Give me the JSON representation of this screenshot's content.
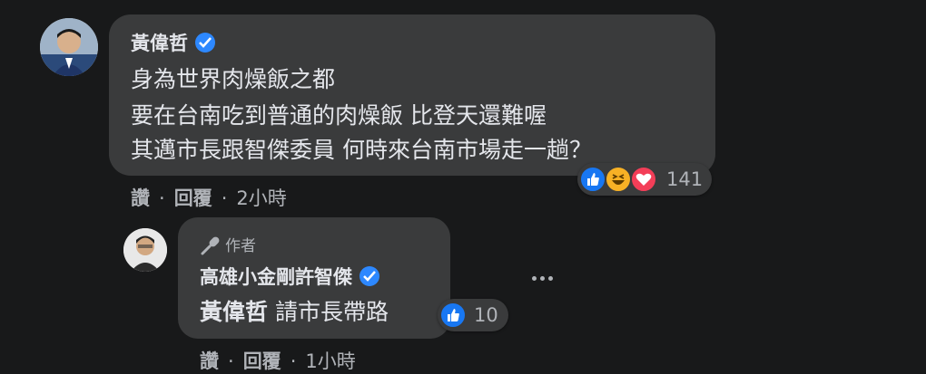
{
  "comment": {
    "author": "黃偉哲",
    "lines": [
      "身為世界肉燥飯之都",
      "要在台南吃到普通的肉燥飯 比登天還難喔",
      "其邁市長跟智傑委員 何時來台南市場走一趟？"
    ],
    "actions": {
      "like": "讚",
      "reply": "回覆",
      "time": "2小時"
    },
    "reactions": {
      "icons": [
        "like-icon",
        "haha-icon",
        "love-icon"
      ],
      "count": "141"
    }
  },
  "reply": {
    "badge": "作者",
    "author": "高雄小金剛許智傑",
    "mention": "黃偉哲",
    "text": "請市長帶路",
    "actions": {
      "like": "讚",
      "reply": "回覆",
      "time": "1小時"
    },
    "reactions": {
      "icons": [
        "like-icon"
      ],
      "count": "10"
    }
  },
  "colors": {
    "background": "#18191a",
    "bubble": "#3a3b3c",
    "verified": "#2d88ff",
    "like": "#1877f2",
    "haha": "#f7b125",
    "love": "#f33e58"
  }
}
